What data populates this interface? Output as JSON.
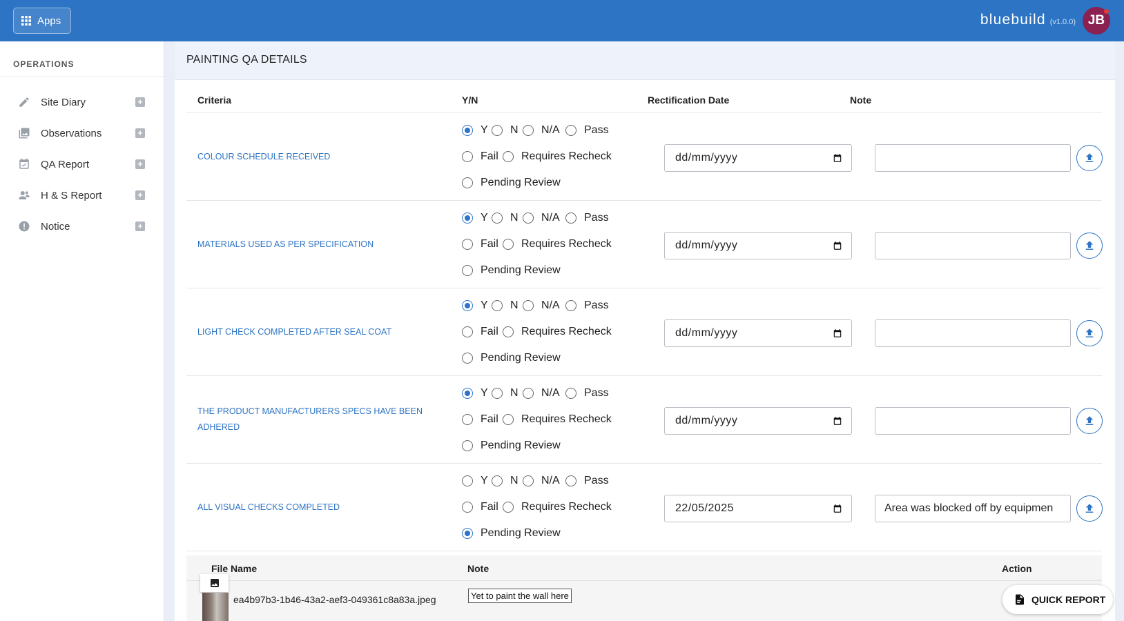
{
  "topbar": {
    "apps_label": "Apps",
    "brand": "bluebuild",
    "version": "(v1.0.0)",
    "avatar_initials": "JB",
    "color": "#2d74c4"
  },
  "sidebar": {
    "section_title": "OPERATIONS",
    "items": [
      {
        "label": "Site Diary",
        "icon": "pencil-icon"
      },
      {
        "label": "Observations",
        "icon": "images-icon"
      },
      {
        "label": "QA Report",
        "icon": "calendar-check-icon"
      },
      {
        "label": "H & S Report",
        "icon": "people-icon"
      },
      {
        "label": "Notice",
        "icon": "alert-circle-icon"
      }
    ]
  },
  "panel": {
    "title": "PAINTING QA DETAILS",
    "columns": {
      "criteria": "Criteria",
      "yn": "Y/N",
      "date": "Rectification Date",
      "note": "Note"
    },
    "options": [
      "Y",
      "N",
      "N/A",
      "Pass",
      "Fail",
      "Requires Recheck",
      "Pending Review"
    ],
    "rows": [
      {
        "criteria_line1": "COLOUR SCHEDULE RECEIVED",
        "criteria_line2": "",
        "selected": "Y",
        "date": "dd/mm/yyyy",
        "note": ""
      },
      {
        "criteria_line1": "MATERIALS USED AS PER SPECIFICATION",
        "criteria_line2": "",
        "selected": "Y",
        "date": "dd/mm/yyyy",
        "note": ""
      },
      {
        "criteria_line1": "LIGHT CHECK COMPLETED AFTER SEAL COAT",
        "criteria_line2": "",
        "selected": "Y",
        "date": "dd/mm/yyyy",
        "note": ""
      },
      {
        "criteria_line1": "THE PRODUCT MANUFACTURERS SPECS HAVE BEEN",
        "criteria_line2": "ADHERED",
        "selected": "Y",
        "date": "dd/mm/yyyy",
        "note": ""
      },
      {
        "criteria_line1": "ALL VISUAL CHECKS COMPLETED",
        "criteria_line2": "",
        "selected": "Pending Review",
        "date": "22/05/2025",
        "note": "Area was blocked off by equipmen"
      }
    ],
    "files": {
      "columns": {
        "file_name": "File Name",
        "note": "Note",
        "action": "Action"
      },
      "items": [
        {
          "file_name": "ea4b97b3-1b46-43a2-aef3-049361c8a83a.jpeg",
          "note": "Yet to paint the wall here"
        }
      ]
    }
  },
  "quick_report_label": "QUICK REPORT"
}
